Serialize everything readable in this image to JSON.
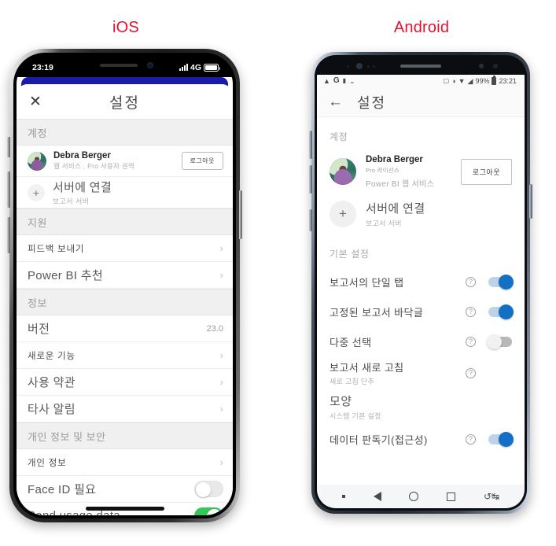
{
  "captions": {
    "ios": "iOS",
    "android": "Android",
    "accent_color": "#e8112d"
  },
  "ios": {
    "status": {
      "time": "23:19",
      "network": "4G",
      "signal_icon": "signal-bars-icon",
      "battery_icon": "battery-icon"
    },
    "header": {
      "close_label": "✕",
      "title": "설정"
    },
    "sections": [
      {
        "header": "계정",
        "rows": [
          {
            "type": "account",
            "name": "Debra Berger",
            "sub": "웹 서비스 , Pro 사용자 권역",
            "button": "로그아웃"
          },
          {
            "type": "connect",
            "title": "서버에 연결",
            "sub": "보고서 서버",
            "icon": "plus-icon"
          }
        ]
      },
      {
        "header": "지원",
        "rows": [
          {
            "type": "chevron",
            "title": "피드백 보내기",
            "small": true
          },
          {
            "type": "chevron",
            "title": "Power BI 추천"
          }
        ]
      },
      {
        "header": "정보",
        "rows": [
          {
            "type": "value",
            "title": "버전",
            "value": "23.0"
          },
          {
            "type": "chevron",
            "title": "새로운 기능",
            "small": true
          },
          {
            "type": "chevron",
            "title": "사용 약관"
          },
          {
            "type": "chevron",
            "title": "타사 알림"
          }
        ]
      },
      {
        "header": "개인 정보 및 보안",
        "rows": [
          {
            "type": "chevron",
            "title": "개인 정보",
            "small": true
          },
          {
            "type": "toggle",
            "title": "Face ID 필요",
            "on": false
          },
          {
            "type": "toggle",
            "title": "Send usage data",
            "on": true
          }
        ]
      }
    ]
  },
  "android": {
    "status": {
      "left_icons": [
        "warning-triangle-icon",
        "google-g-icon",
        "screenshot-icon",
        "download-complete-icon"
      ],
      "right_icons": [
        "nfc-icon",
        "vibrate-icon",
        "wifi-icon",
        "no-sim-icon"
      ],
      "battery_percent": "99%",
      "battery_icon": "battery-icon",
      "time": "23:21"
    },
    "appbar": {
      "back_label": "←",
      "title": "설정"
    },
    "sections": [
      {
        "header": "계정",
        "rows": [
          {
            "type": "account",
            "name": "Debra Berger",
            "sub1": "Pro 라이선스",
            "sub2": "Power BI 웹 서비스",
            "button": "로그아웃"
          },
          {
            "type": "connect",
            "title": "서버에 연결",
            "sub": "보고서 서버",
            "icon": "plus-icon"
          }
        ]
      },
      {
        "header": "기본 설정",
        "rows": [
          {
            "type": "toggle",
            "title": "보고서의 단일 탭",
            "help": true,
            "on": true
          },
          {
            "type": "toggle",
            "title": "고정된 보고서 바닥글",
            "help": true,
            "on": true
          },
          {
            "type": "toggle",
            "title": "다중 선택",
            "help": true,
            "on": false
          },
          {
            "type": "plain",
            "title": "보고서 새로 고침",
            "sub": "새로 고침 단추",
            "help": true
          },
          {
            "type": "plain",
            "title": "모양",
            "sub": "시스템 기본 설정",
            "help": false,
            "large": true
          },
          {
            "type": "toggle",
            "title": "데이터 판독기(접근성)",
            "help": true,
            "on": true
          }
        ]
      }
    ],
    "navbar": {
      "items": [
        "dot-icon",
        "back-triangle-icon",
        "home-circle-icon",
        "recents-square-icon",
        "rotate-screen-icon"
      ]
    }
  }
}
